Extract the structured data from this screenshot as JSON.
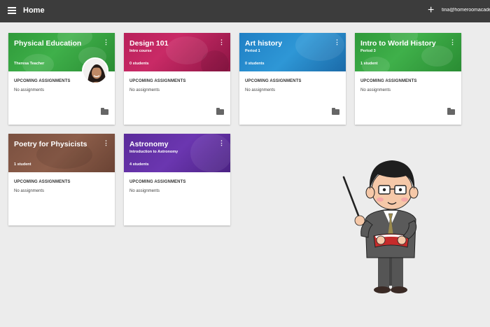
{
  "topbar": {
    "title": "Home",
    "add": "+",
    "email": "tina@homeroomacademy"
  },
  "cards": [
    {
      "title": "Physical Education",
      "subtitle": "Theresa Teacher",
      "count": "",
      "heading": "UPCOMING ASSIGNMENTS",
      "assignments": "No assignments",
      "more": "⋮",
      "color": "#35a240"
    },
    {
      "title": "Design 101",
      "subtitle": "Intro course",
      "count": "0 students",
      "heading": "UPCOMING ASSIGNMENTS",
      "assignments": "No assignments",
      "more": "⋮",
      "color": "#c02560"
    },
    {
      "title": "Art history",
      "subtitle": "Period 1",
      "count": "0 students",
      "heading": "UPCOMING ASSIGNMENTS",
      "assignments": "No assignments",
      "more": "⋮",
      "color": "#2789cc"
    },
    {
      "title": "Intro to World History",
      "subtitle": "Period 3",
      "count": "1 student",
      "heading": "UPCOMING ASSIGNMENTS",
      "assignments": "No assignments",
      "more": "⋮",
      "color": "#35a240"
    },
    {
      "title": "Poetry for Physicists",
      "subtitle": "",
      "count": "1 student",
      "heading": "UPCOMING ASSIGNMENTS",
      "assignments": "No assignments",
      "more": "⋮",
      "color": "#7e5443"
    },
    {
      "title": "Astronomy",
      "subtitle": "Introduction to Astronomy",
      "count": "4 students",
      "heading": "UPCOMING ASSIGNMENTS",
      "assignments": "No assignments",
      "more": "⋮",
      "color": "#6232a6"
    }
  ]
}
